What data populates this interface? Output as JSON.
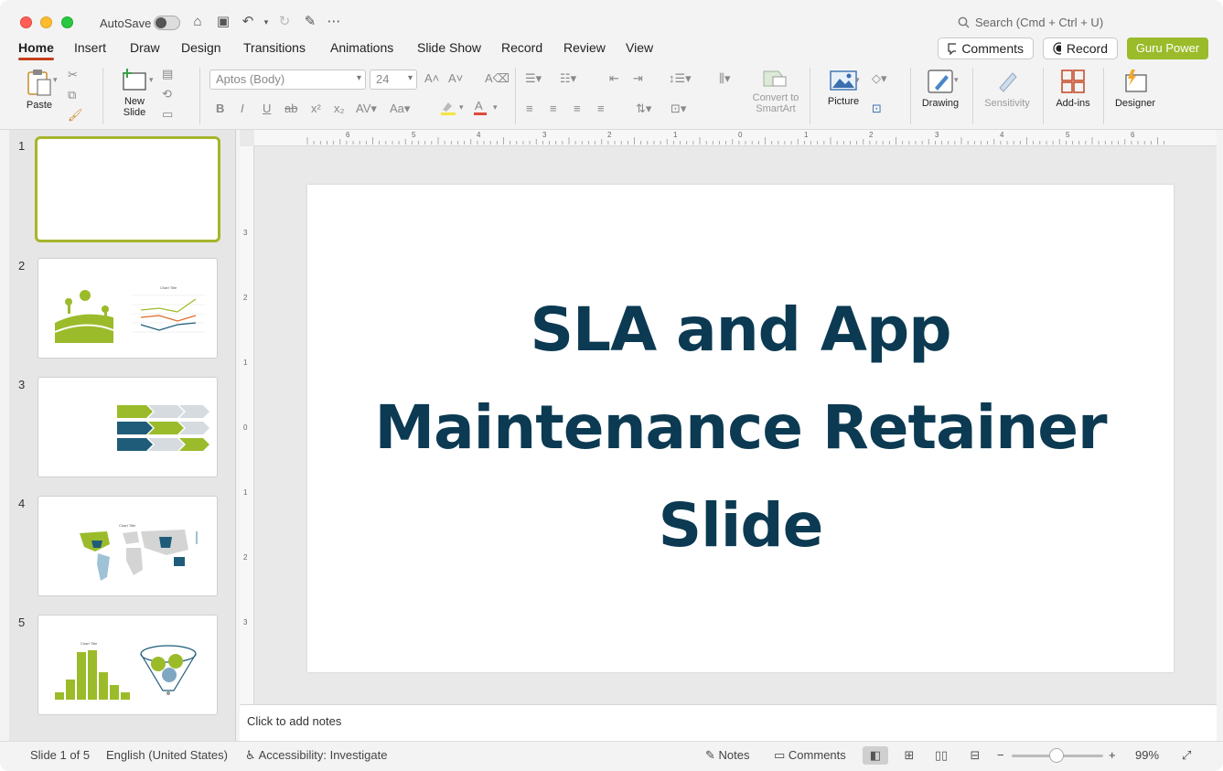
{
  "titlebar": {
    "autosave_label": "AutoSave",
    "search_placeholder": "Search (Cmd + Ctrl + U)"
  },
  "tabs": [
    {
      "label": "Home"
    },
    {
      "label": "Insert"
    },
    {
      "label": "Draw"
    },
    {
      "label": "Design"
    },
    {
      "label": "Transitions"
    },
    {
      "label": "Animations"
    },
    {
      "label": "Slide Show"
    },
    {
      "label": "Record"
    },
    {
      "label": "Review"
    },
    {
      "label": "View"
    }
  ],
  "header_buttons": {
    "comments": "Comments",
    "record": "Record",
    "guru": "Guru Power"
  },
  "ribbon": {
    "paste": "Paste",
    "new_slide": "New\nSlide",
    "font_name": "Aptos (Body)",
    "font_size": "24",
    "convert_smartart": "Convert to\nSmartArt",
    "picture": "Picture",
    "drawing": "Drawing",
    "sensitivity": "Sensitivity",
    "addins": "Add-ins",
    "designer": "Designer"
  },
  "thumbnails": [
    {
      "num": "1"
    },
    {
      "num": "2"
    },
    {
      "num": "3"
    },
    {
      "num": "4"
    },
    {
      "num": "5"
    }
  ],
  "thumb_labels": {
    "chart_title": "Chart Title"
  },
  "ruler": {
    "h": [
      "6",
      "5",
      "4",
      "3",
      "2",
      "1",
      "0",
      "1",
      "2",
      "3",
      "4",
      "5",
      "6"
    ],
    "v": [
      "3",
      "2",
      "1",
      "0",
      "1",
      "2",
      "3"
    ]
  },
  "slide": {
    "title_line1": "SLA and App",
    "title_line2": "Maintenance Retainer",
    "title_line3": "Slide"
  },
  "notes": {
    "placeholder": "Click to add notes"
  },
  "status": {
    "slide_count": "Slide 1 of 5",
    "language": "English (United States)",
    "accessibility": "Accessibility: Investigate",
    "notes": "Notes",
    "comments": "Comments",
    "zoom": "99%"
  },
  "colors": {
    "accent_green": "#9bbb2b",
    "title_navy": "#0b3a52",
    "tab_underline": "#c43e1c"
  }
}
